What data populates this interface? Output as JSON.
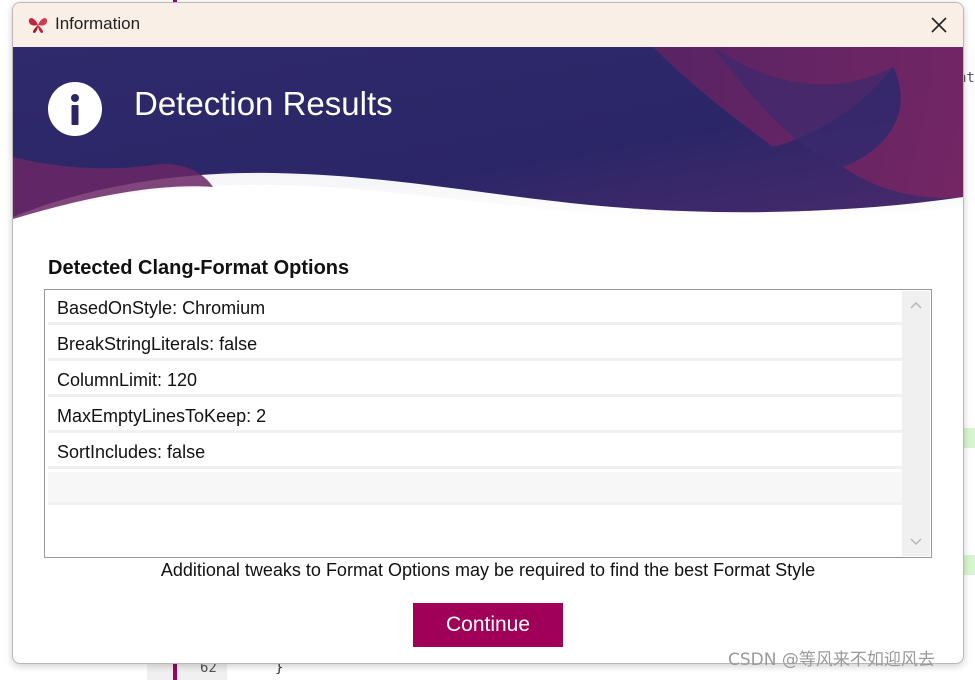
{
  "window": {
    "title": "Information",
    "logo_icon": "butterfly-logo-icon",
    "close_icon": "close-icon"
  },
  "banner": {
    "title": "Detection Results",
    "icon": "info-icon",
    "colors": {
      "dark": "#2b2667",
      "magenta": "#7a2563"
    }
  },
  "options": {
    "heading": "Detected Clang-Format Options",
    "items": [
      "BasedOnStyle: Chromium",
      "BreakStringLiterals: false",
      "ColumnLimit: 120",
      "MaxEmptyLinesToKeep: 2",
      "SortIncludes: false",
      ""
    ]
  },
  "note": "Additional tweaks to Format Options may be required to find the best Format Style",
  "continue_label": "Continue",
  "accent_color": "#a10058",
  "background": {
    "line_number": "62",
    "brace": "}",
    "edge_text": "at",
    "snippet": "…"
  },
  "watermark": "CSDN @等风来不如迎风去"
}
